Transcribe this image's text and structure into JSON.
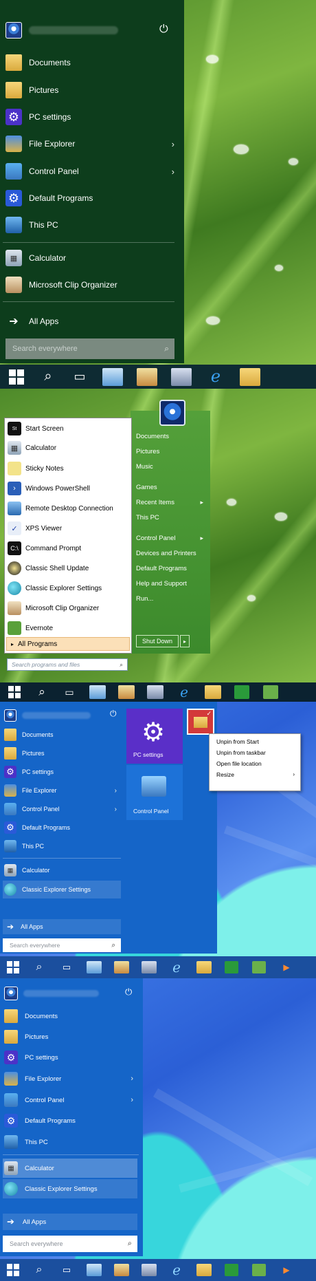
{
  "panel1": {
    "menu_items": [
      "Documents",
      "Pictures",
      "PC settings",
      "File Explorer",
      "Control Panel",
      "Default Programs",
      "This PC",
      "Calculator",
      "Microsoft Clip Organizer"
    ],
    "all_apps": "All Apps",
    "search_placeholder": "Search everywhere"
  },
  "panel2": {
    "left_items": [
      "Start Screen",
      "Calculator",
      "Sticky Notes",
      "Windows PowerShell",
      "Remote Desktop Connection",
      "XPS Viewer",
      "Command Prompt",
      "Classic Shell Update",
      "Classic Explorer Settings",
      "Microsoft Clip Organizer",
      "Evernote"
    ],
    "all_programs": "All Programs",
    "search_placeholder": "Search programs and files",
    "right_items": [
      "Documents",
      "Pictures",
      "Music",
      "Games",
      "Recent Items",
      "This PC",
      "Control Panel",
      "Devices and Printers",
      "Default Programs",
      "Help and Support",
      "Run..."
    ],
    "shutdown": "Shut Down"
  },
  "panel3": {
    "menu_items": [
      "Documents",
      "Pictures",
      "PC settings",
      "File Explorer",
      "Control Panel",
      "Default Programs",
      "This PC",
      "Calculator",
      "Classic Explorer Settings"
    ],
    "all_apps": "All Apps",
    "search_placeholder": "Search everywhere",
    "tiles": [
      "PC settings",
      "Control Panel"
    ],
    "context_menu": [
      "Unpin from Start",
      "Unpin from taskbar",
      "Open file location",
      "Resize"
    ]
  },
  "panel4": {
    "menu_items": [
      "Documents",
      "Pictures",
      "PC settings",
      "File Explorer",
      "Control Panel",
      "Default Programs",
      "This PC",
      "Calculator",
      "Classic Explorer Settings"
    ],
    "all_apps": "All Apps",
    "search_placeholder": "Search everywhere"
  },
  "icons": {
    "power": "power-icon",
    "arrow": "arrow-right-icon",
    "chevron": "chevron-right-icon",
    "search": "search-icon",
    "windows": "windows-logo-icon"
  },
  "colors": {
    "green_menu": "#0d3d1c",
    "blue_menu": "#1565c8",
    "taskbar": "#0a1e2a"
  }
}
